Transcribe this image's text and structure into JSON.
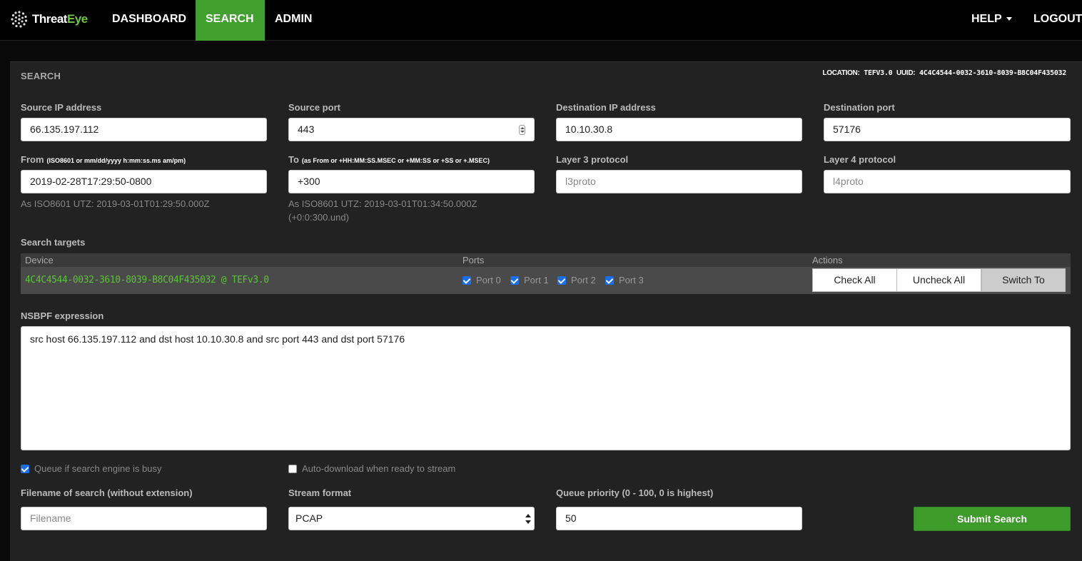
{
  "brand": {
    "name_prefix": "Threat",
    "name_accent": "Eye"
  },
  "nav": {
    "items": [
      {
        "label": "DASHBOARD"
      },
      {
        "label": "SEARCH",
        "active": true
      },
      {
        "label": "ADMIN"
      }
    ],
    "help_label": "HELP",
    "logout_label": "LOGOUT"
  },
  "panel": {
    "title": "SEARCH",
    "location_label": "LOCATION:",
    "location_value": "TEFV3.0",
    "uuid_label": "UUID:",
    "uuid_value": "4C4C4544-0032-3610-8039-B8C04F435032"
  },
  "fields": {
    "src_ip": {
      "label": "Source IP address",
      "value": "66.135.197.112"
    },
    "src_port": {
      "label": "Source port",
      "value": "443"
    },
    "dst_ip": {
      "label": "Destination IP address",
      "value": "10.10.30.8"
    },
    "dst_port": {
      "label": "Destination port",
      "value": "57176"
    },
    "from": {
      "label": "From",
      "hint": "(ISO8601 or mm/dd/yyyy h:mm:ss.ms am/pm)",
      "value": "2019-02-28T17:29:50-0800",
      "help": "As ISO8601 UTZ: 2019-03-01T01:29:50.000Z"
    },
    "to": {
      "label": "To",
      "hint": "(as From or +HH:MM:SS.MSEC or +MM:SS or +SS or +.MSEC)",
      "value": "+300",
      "help1": "As ISO8601 UTZ: 2019-03-01T01:34:50.000Z",
      "help2": "(+0:0:300.und)"
    },
    "l3": {
      "label": "Layer 3 protocol",
      "placeholder": "l3proto"
    },
    "l4": {
      "label": "Layer 4 protocol",
      "placeholder": "l4proto"
    }
  },
  "targets": {
    "label": "Search targets",
    "headers": {
      "device": "Device",
      "ports": "Ports",
      "actions": "Actions"
    },
    "device": "4C4C4544-0032-3610-8039-B8C04F435032 @ TEFv3.0",
    "ports": [
      "Port 0",
      "Port 1",
      "Port 2",
      "Port 3"
    ],
    "buttons": {
      "check_all": "Check All",
      "uncheck_all": "Uncheck All",
      "switch_to": "Switch To"
    }
  },
  "nsbpf": {
    "label": "NSBPF expression",
    "value": "src host 66.135.197.112 and dst host 10.10.30.8 and src port 443 and dst port 57176"
  },
  "options": {
    "queue_if_busy": {
      "label": "Queue if search engine is busy",
      "checked": true
    },
    "auto_download": {
      "label": "Auto-download when ready to stream",
      "checked": false
    }
  },
  "bottom": {
    "filename": {
      "label": "Filename of search (without extension)",
      "placeholder": "Filename"
    },
    "stream_format": {
      "label": "Stream format",
      "value": "PCAP"
    },
    "priority": {
      "label": "Queue priority (0 - 100, 0 is highest)",
      "value": "50"
    },
    "submit_label": "Submit Search"
  },
  "colors": {
    "accent_green": "#41a030",
    "device_green": "#5cc13a",
    "checkbox_blue": "#1a6ee8"
  }
}
